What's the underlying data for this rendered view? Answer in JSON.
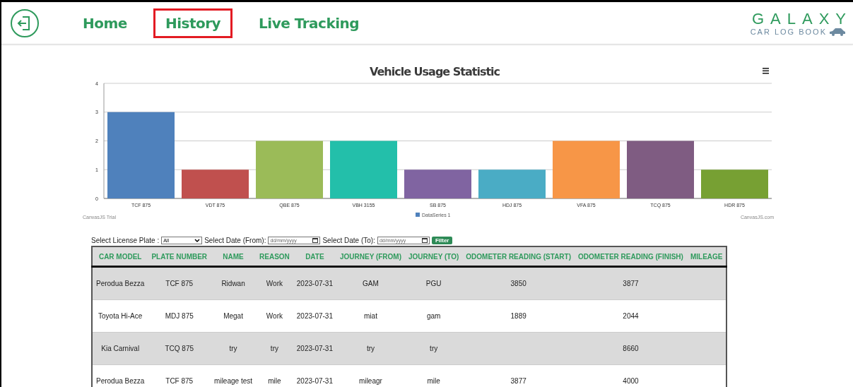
{
  "nav": [
    {
      "label": "Home",
      "selected": false
    },
    {
      "label": "History",
      "selected": true
    },
    {
      "label": "Live Tracking",
      "selected": false
    }
  ],
  "brand": {
    "title": "GALAXY",
    "subtitle": "CAR LOG BOOK"
  },
  "chart": {
    "chart_data": {
      "type": "bar",
      "title": "Vehicle Usage Statistic",
      "categories": [
        "TCF 875",
        "VDT 875",
        "QBE 875",
        "VBH 3155",
        "SB 875",
        "HDJ 875",
        "VFA 875",
        "TCQ 875",
        "HDR 875"
      ],
      "series": [
        {
          "name": "DataSeries 1",
          "color": "#4f81bc",
          "values": [
            3,
            1,
            2,
            2,
            1,
            1,
            2,
            2,
            1
          ],
          "colors": [
            "#4f81bc",
            "#c0504e",
            "#9bbb58",
            "#23bfaa",
            "#8064a1",
            "#4aacc5",
            "#f79647",
            "#7f5c82",
            "#77a033"
          ]
        }
      ],
      "ylim": [
        0,
        4
      ],
      "yticks": [
        0,
        1,
        2,
        3,
        4
      ],
      "grid": true
    },
    "credit_left": "CanvasJS Trial",
    "credit_right": "CanvasJS.com"
  },
  "filters": {
    "plate_label": "Select License Plate :",
    "plate_value": "All",
    "from_label": "Select Date (From):",
    "from_placeholder": "dd/mm/yyyy",
    "to_label": "Select Date (To):",
    "to_placeholder": "dd/mm/yyyy",
    "button": "Filter"
  },
  "table": {
    "columns": [
      "CAR MODEL",
      "PLATE NUMBER",
      "NAME",
      "REASON",
      "DATE",
      "JOURNEY (FROM)",
      "JOURNEY (TO)",
      "ODOMETER READING (START)",
      "ODOMETER READING (FINISH)",
      "MILEAGE"
    ],
    "rows": [
      [
        "Perodua Bezza",
        "TCF 875",
        "Ridwan",
        "Work",
        "2023-07-31",
        "GAM",
        "PGU",
        "3850",
        "3877",
        null
      ],
      [
        "Toyota Hi-Ace",
        "MDJ 875",
        "Megat",
        "Work",
        "2023-07-31",
        "miat",
        "gam",
        "1889",
        "2044",
        null
      ],
      [
        "Kia Carnival",
        "TCQ 875",
        "try",
        "try",
        "2023-07-31",
        "try",
        "try",
        null,
        "8660",
        null
      ],
      [
        "Perodua Bezza",
        "TCF 875",
        "mileage test",
        "mile",
        "2023-07-31",
        "mileagr",
        "mile",
        "3877",
        "4000",
        null
      ]
    ]
  }
}
